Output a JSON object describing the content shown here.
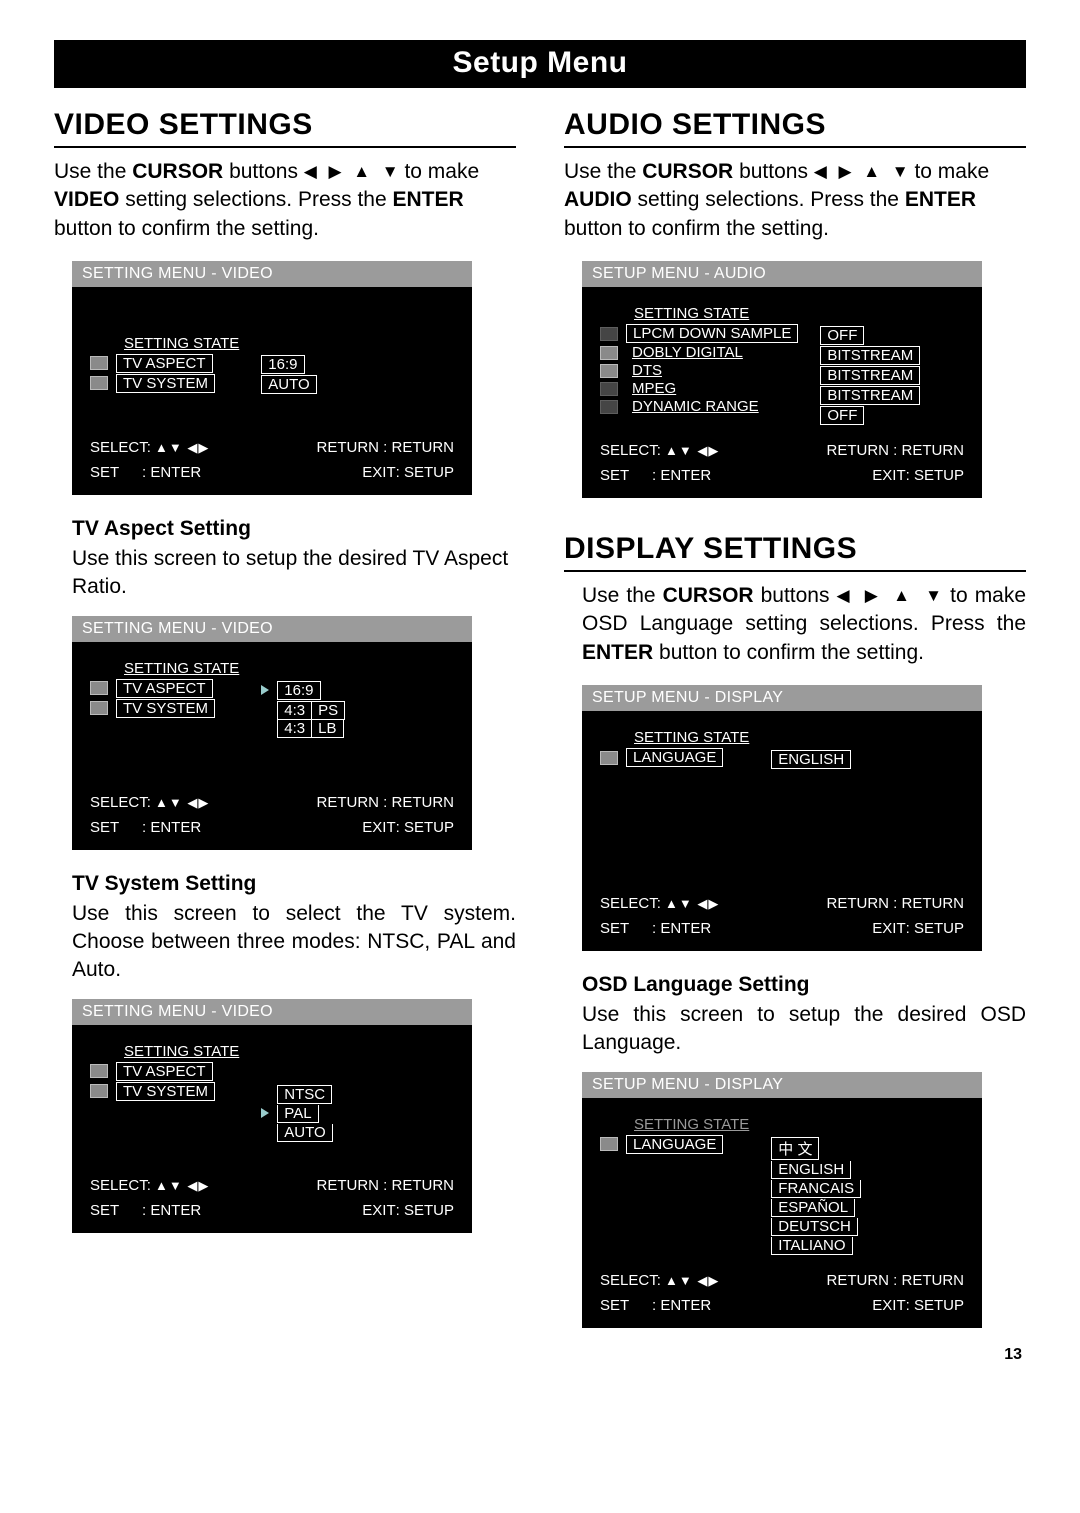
{
  "page_number": "13",
  "banner": "Setup Menu",
  "glyphs": {
    "left": "◀",
    "right": "▶",
    "up": "▲",
    "down": "▼"
  },
  "video": {
    "heading": "VIDEO SETTINGS",
    "intro_pre": "Use the ",
    "intro_cursor": "CURSOR",
    "intro_mid1": " buttons ",
    "intro_mid2": " to make ",
    "intro_bold2": "VIDEO",
    "intro_mid3": " setting selections. Press the ",
    "intro_enter": "ENTER",
    "intro_post": " button to confirm the setting.",
    "panel1": {
      "title": "SETTING MENU - VIDEO",
      "state": "SETTING STATE",
      "rows": [
        {
          "label": "TV ASPECT",
          "value": "16:9"
        },
        {
          "label": "TV SYSTEM",
          "value": "AUTO"
        }
      ]
    },
    "tv_aspect": {
      "heading": "TV Aspect Setting",
      "text": "Use this screen to setup the desired TV Aspect Ratio.",
      "panel": {
        "title": "SETTING MENU - VIDEO",
        "state": "SETTING STATE",
        "left": [
          "TV ASPECT",
          "TV SYSTEM"
        ],
        "options": [
          {
            "a": "16:9",
            "b": ""
          },
          {
            "a": "4:3",
            "b": "PS"
          },
          {
            "a": "4:3",
            "b": "LB"
          }
        ]
      }
    },
    "tv_system": {
      "heading": "TV System Setting",
      "text": "Use this screen to select the TV system. Choose between three modes: NTSC, PAL and Auto.",
      "panel": {
        "title": "SETTING MENU - VIDEO",
        "state": "SETTING STATE",
        "left": [
          "TV ASPECT",
          "TV SYSTEM"
        ],
        "options": [
          "NTSC",
          "PAL",
          "AUTO"
        ]
      }
    }
  },
  "audio": {
    "heading": "AUDIO SETTINGS",
    "intro_pre": "Use the ",
    "intro_cursor": "CURSOR",
    "intro_mid1": " buttons ",
    "intro_mid2": "  to make ",
    "intro_bold2": "AUDIO",
    "intro_mid3": " setting selections. Press the ",
    "intro_enter": "ENTER",
    "intro_post": " button to confirm the setting.",
    "panel": {
      "title": "SETUP MENU - AUDIO",
      "state": "SETTING STATE",
      "rows": [
        {
          "label": "LPCM DOWN SAMPLE",
          "value": "OFF"
        },
        {
          "label": "DOBLY DIGITAL",
          "value": "BITSTREAM"
        },
        {
          "label": "DTS",
          "value": "BITSTREAM"
        },
        {
          "label": "MPEG",
          "value": "BITSTREAM"
        },
        {
          "label": "DYNAMIC RANGE",
          "value": "OFF"
        }
      ]
    }
  },
  "display": {
    "heading": "DISPLAY SETTINGS",
    "intro_pre": "Use the ",
    "intro_cursor": "CURSOR",
    "intro_mid1": " buttons ",
    "intro_mid2": " to make OSD Language setting selections. Press the ",
    "intro_enter": "ENTER",
    "intro_post": " button to confirm the setting.",
    "panel1": {
      "title": "SETUP MENU - DISPLAY",
      "state": "SETTING STATE",
      "rows": [
        {
          "label": "LANGUAGE",
          "value": "ENGLISH"
        }
      ]
    },
    "osd_lang": {
      "heading": "OSD Language Setting",
      "text": "Use this screen to setup the desired OSD Language.",
      "panel": {
        "title": "SETUP MENU - DISPLAY",
        "state": "SETTING STATE",
        "left_label": "LANGUAGE",
        "options": [
          "中 文",
          "ENGLISH",
          "FRANCAIS",
          "ESPAÑOL",
          "DEUTSCH",
          "ITALIANO"
        ]
      }
    }
  },
  "footer": {
    "select": "SELECT:",
    "return": "RETURN : RETURN",
    "set": "SET",
    "enter": ": ENTER",
    "exit": "EXIT",
    "setup": ": SETUP"
  }
}
